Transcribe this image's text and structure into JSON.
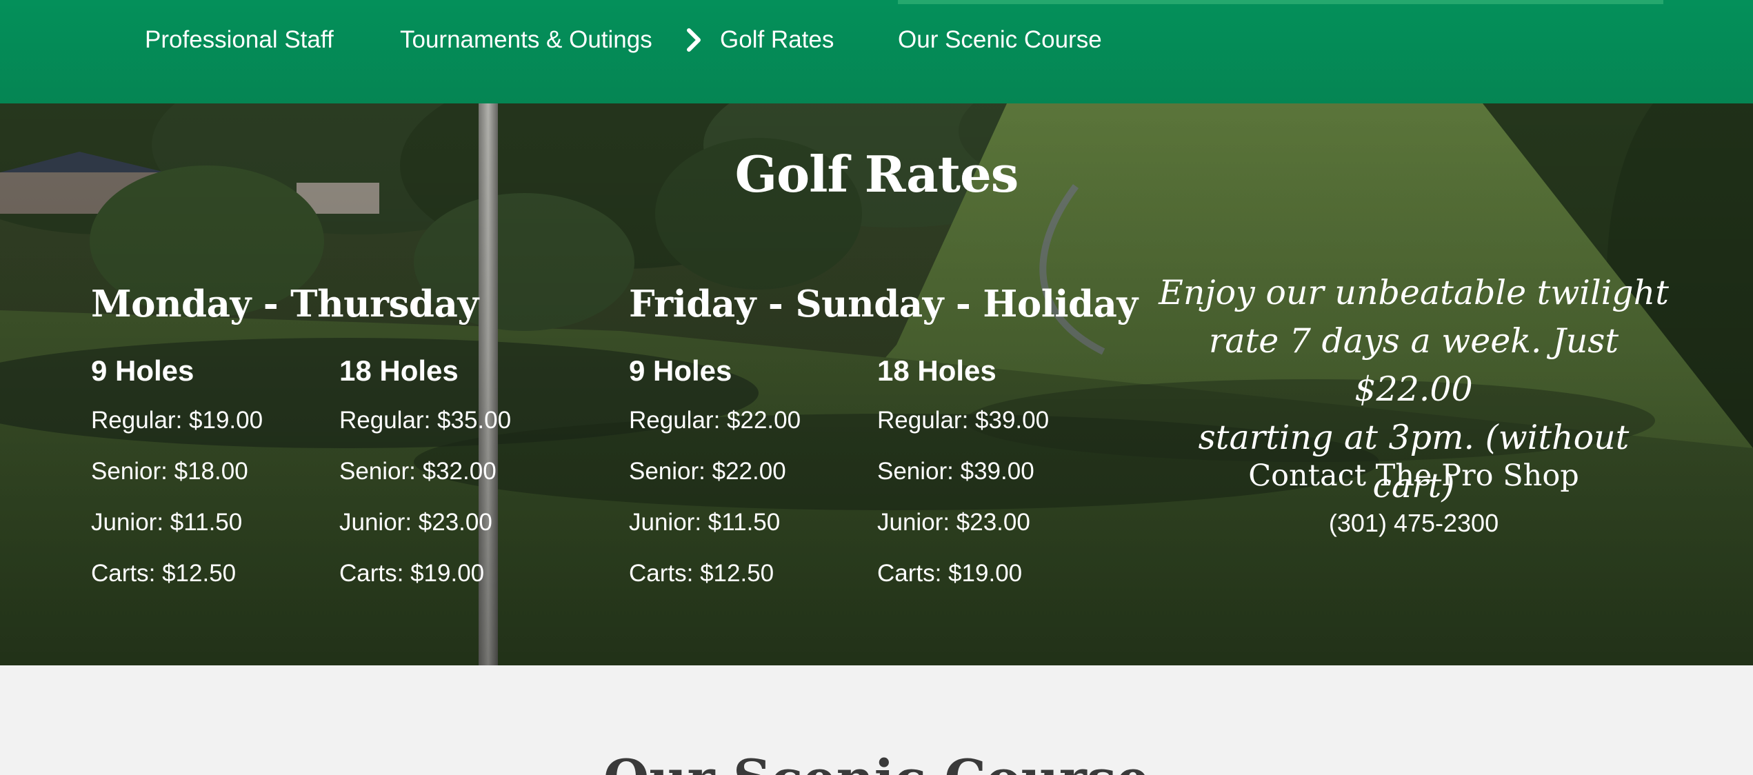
{
  "nav": {
    "items": [
      {
        "label": "Professional Staff"
      },
      {
        "label": "Tournaments & Outings"
      },
      {
        "label": "Golf Rates"
      },
      {
        "label": "Our Scenic Course"
      }
    ],
    "active_index": 2,
    "active_indicator_icon": "chevron-right-icon"
  },
  "hero": {
    "title": "Golf Rates",
    "weekday": {
      "heading": "Monday - Thursday",
      "nine": {
        "heading": "9 Holes",
        "rates": [
          "Regular: $19.00",
          "Senior: $18.00",
          "Junior: $11.50",
          "Carts: $12.50"
        ]
      },
      "eighteen": {
        "heading": "18 Holes",
        "rates": [
          "Regular: $35.00",
          "Senior: $32.00",
          "Junior: $23.00",
          "Carts: $19.00"
        ]
      }
    },
    "weekend": {
      "heading": "Friday - Sunday - Holiday",
      "nine": {
        "heading": "9 Holes",
        "rates": [
          "Regular: $22.00",
          "Senior: $22.00",
          "Junior: $11.50",
          "Carts: $12.50"
        ]
      },
      "eighteen": {
        "heading": "18 Holes",
        "rates": [
          "Regular: $39.00",
          "Senior: $39.00",
          "Junior: $23.00",
          "Carts: $19.00"
        ]
      }
    },
    "promo": {
      "line1": "Enjoy our unbeatable twilight",
      "line2": "rate 7 days a week. Just $22.00",
      "line3": "starting at 3pm. (without cart)"
    },
    "contact": {
      "heading": "Contact The Pro Shop",
      "phone": "(301) 475-2300"
    }
  },
  "next_section": {
    "title": "Our Scenic Course"
  },
  "colors": {
    "nav_green": "#058553",
    "nav_accent": "#25a86e",
    "text_white": "#ffffff",
    "section_bg": "#f2f2f2",
    "heading_dark": "#3a3a3a"
  }
}
